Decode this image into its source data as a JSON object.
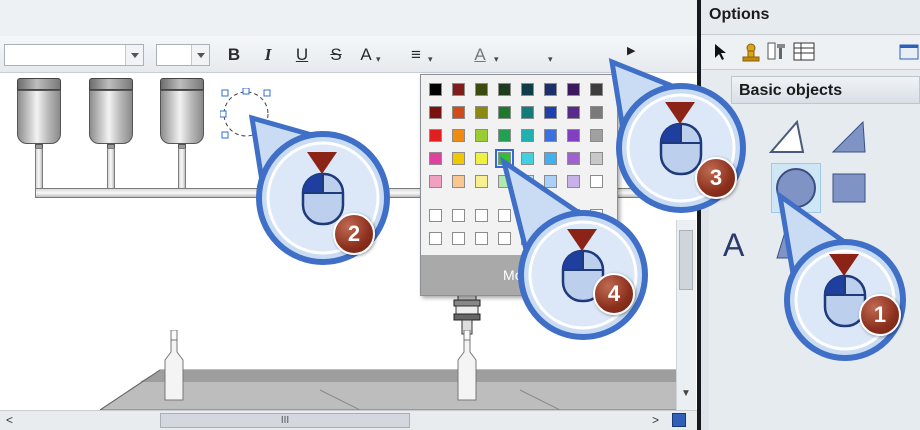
{
  "toolbar": {
    "bold": "B",
    "italic": "I",
    "underline": "U",
    "strikethrough": "S",
    "font_size_up": "A",
    "align": "≡",
    "font_color": "A",
    "fill_color_icon": "fill-bucket-icon",
    "line_color_icon": "paint-brush-icon",
    "overflow_icon": "play-arrow-icon"
  },
  "palette": {
    "rows": [
      [
        "#000000",
        "#7f1d1d",
        "#3b4a10",
        "#1d3b1d",
        "#0f3d4a",
        "#1a2f6b",
        "#3a1a5c",
        "#3d3d3d"
      ],
      [
        "#7a1010",
        "#d04a1a",
        "#8a8a10",
        "#1e7a2a",
        "#157a7a",
        "#1e3fb0",
        "#5a2a8a",
        "#7a7a7a"
      ],
      [
        "#e02020",
        "#f08a10",
        "#9acd32",
        "#20a050",
        "#20b0b0",
        "#3a70e0",
        "#8040c0",
        "#a0a0a0"
      ],
      [
        "#e040a0",
        "#f0c800",
        "#f0f040",
        "#30c030",
        "#40d0e0",
        "#40b0f0",
        "#a060d0",
        "#c8c8c8"
      ],
      [
        "#f0a0c0",
        "#f8c890",
        "#f8f090",
        "#b0e8b0",
        "#b0e8f0",
        "#a8d0f8",
        "#c8b0e8",
        "#ffffff"
      ]
    ],
    "custom_rows": 2,
    "more_label": "More",
    "selected": "#30c030"
  },
  "options": {
    "title": "Options",
    "section": "Basic objects",
    "tool_icons": [
      "pointer-icon",
      "stamp-icon",
      "properties-icon",
      "table-icon",
      "window-icon"
    ],
    "objects": [
      "line-icon",
      "polyline-icon",
      "polygon-icon",
      "ellipse-icon",
      "circle-icon",
      "rectangle-icon",
      "text-icon",
      "graphic-icon"
    ]
  },
  "callouts": [
    {
      "number": "1"
    },
    {
      "number": "2"
    },
    {
      "number": "3"
    },
    {
      "number": "4"
    }
  ],
  "scrollbars": {
    "h_grip": "III"
  },
  "colors": {
    "callout_ring": "#3f6fc6",
    "callout_fill": "#c9dcf4",
    "badge": "#8b2f1d",
    "panel_border": "#15181c"
  }
}
